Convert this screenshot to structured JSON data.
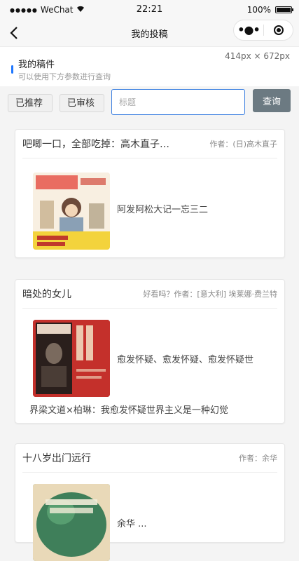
{
  "status_bar": {
    "signal": "●●●●●",
    "carrier": "WeChat",
    "time": "22:21",
    "battery_text": "100%",
    "battery_level": 1.0
  },
  "nav": {
    "title": "我的投稿",
    "more_icon": "more-dots-icon",
    "close_icon": "record-circle-icon"
  },
  "header": {
    "title": "我的稿件",
    "subtitle": "可以使用下方参数进行查询",
    "size_label": "414px × 672px",
    "accent_color": "#1f77ff"
  },
  "filters": {
    "recommended_label": "已推荐",
    "reviewed_label": "已审核",
    "search_placeholder": "标题",
    "search_value": "",
    "query_label": "查询",
    "query_color": "#6c7a82"
  },
  "articles": [
    {
      "title": "吧唧一口，全部吃掉：高木直子…",
      "author": "作者：(日)高木直子",
      "excerpt": "阿发阿松大记一忘三二",
      "excerpt_cont": ""
    },
    {
      "title": "暗处的女儿",
      "author": "好看吗？作者：[意大利] 埃莱娜·费兰特",
      "excerpt": "愈发怀疑、愈发怀疑、愈发怀疑世",
      "excerpt_cont": "界梁文道×柏琳：我愈发怀疑世界主义是一种幻觉"
    },
    {
      "title": "十八岁出门远行",
      "author": "作者：余华",
      "excerpt": "余华 ...",
      "excerpt_cont": ""
    }
  ]
}
